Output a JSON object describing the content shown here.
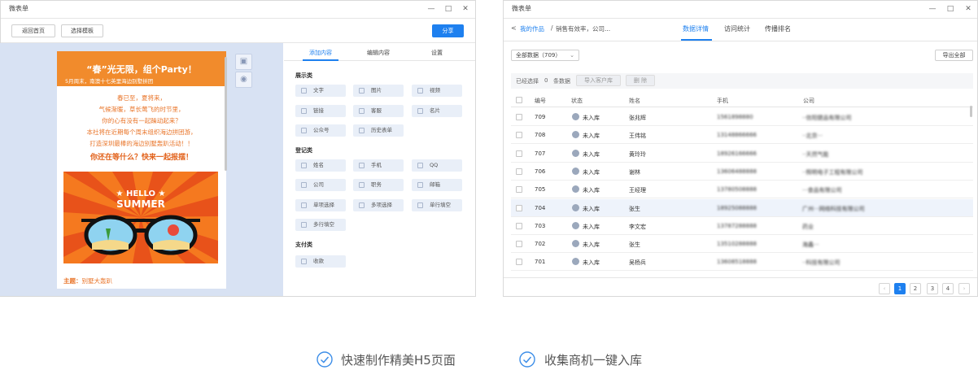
{
  "left_window": {
    "title": "微表单",
    "controls": [
      "—",
      "□",
      "✕"
    ],
    "toolbar": {
      "back": "返回首页",
      "template": "选择模板",
      "share": "分享"
    },
    "tabs": [
      "添加内容",
      "编辑内容",
      "设置"
    ],
    "phone": {
      "title": "“春”光无限，组个Party！",
      "subtitle": "5月周末，南澳十七英里海边别墅拼团",
      "lines": [
        "春已至，夏将来，",
        "气候渐暖，草长莺飞的时节里，",
        "你的心有没有一起躁动起来？",
        "本社将在近期每个周末组织海边拼团游，",
        "打造深圳最棒的海边别墅轰趴活动！！"
      ],
      "bold_line": "你还在等什么？快来一起报摆！",
      "banner_text_1": "★ HELLO ★",
      "banner_text_2": "SUMMER",
      "theme_label": "主题：",
      "theme_value": "别墅大轰趴"
    },
    "sections": {
      "display": {
        "title": "展示类",
        "items": [
          "文字",
          "图片",
          "视频",
          "链接",
          "客服",
          "名片",
          "公众号",
          "历史表单"
        ]
      },
      "register": {
        "title": "登记类",
        "items": [
          "姓名",
          "手机",
          "QQ",
          "公司",
          "职务",
          "邮箱",
          "单项选择",
          "多项选择",
          "单行填空",
          "多行填空"
        ]
      },
      "pay": {
        "title": "支付类",
        "items": [
          "收款"
        ]
      }
    }
  },
  "right_window": {
    "title": "微表单",
    "controls": [
      "—",
      "□",
      "✕"
    ],
    "breadcrumb": {
      "back": "<",
      "root": "我的作品",
      "sep": "/",
      "current": "销售有效率，公司..."
    },
    "tabs": [
      "数据详情",
      "访问统计",
      "传播排名"
    ],
    "filter": "全部数据（709）",
    "export": "导出全部",
    "selected": {
      "label": "已经选择",
      "count": "0",
      "unit": "条数据",
      "import": "导入客户库",
      "delete": "删 除"
    },
    "columns": [
      "编号",
      "状态",
      "姓名",
      "手机",
      "公司"
    ],
    "rows": [
      {
        "id": "709",
        "status": "未入库",
        "name": "张兆辉",
        "phone": "1561898880",
        "company": "··信阳健品有限公司"
      },
      {
        "id": "708",
        "status": "未入库",
        "name": "王伟铭",
        "phone": "13148866666",
        "company": "··北京···"
      },
      {
        "id": "707",
        "status": "未入库",
        "name": "黄玲玲",
        "phone": "18926166666",
        "company": "··天然气能"
      },
      {
        "id": "706",
        "status": "未入库",
        "name": "谢林",
        "phone": "13606488888",
        "company": "··照明电子工程有限公司"
      },
      {
        "id": "705",
        "status": "未入库",
        "name": "王经理",
        "phone": "13780508888",
        "company": "···食品有限公司"
      },
      {
        "id": "704",
        "status": "未入库",
        "name": "张生",
        "phone": "18925088888",
        "company": "广州···网络科技有限公司"
      },
      {
        "id": "703",
        "status": "未入库",
        "name": "李文宏",
        "phone": "13787288888",
        "company": "药业"
      },
      {
        "id": "702",
        "status": "未入库",
        "name": "张生",
        "phone": "13510288888",
        "company": "海鑫···"
      },
      {
        "id": "701",
        "status": "未入库",
        "name": "吴杨兵",
        "phone": "13608518888",
        "company": "··科技有限公司"
      }
    ],
    "pagination": {
      "prev": "‹",
      "pages": [
        "1",
        "2",
        "3",
        "4"
      ],
      "next": "›"
    }
  },
  "captions": [
    "快速制作精美H5页面",
    "收集商机一键入库"
  ],
  "colors": {
    "accent": "#1e80ef",
    "orange": "#f18b2c",
    "check": "#3d8ee8"
  }
}
